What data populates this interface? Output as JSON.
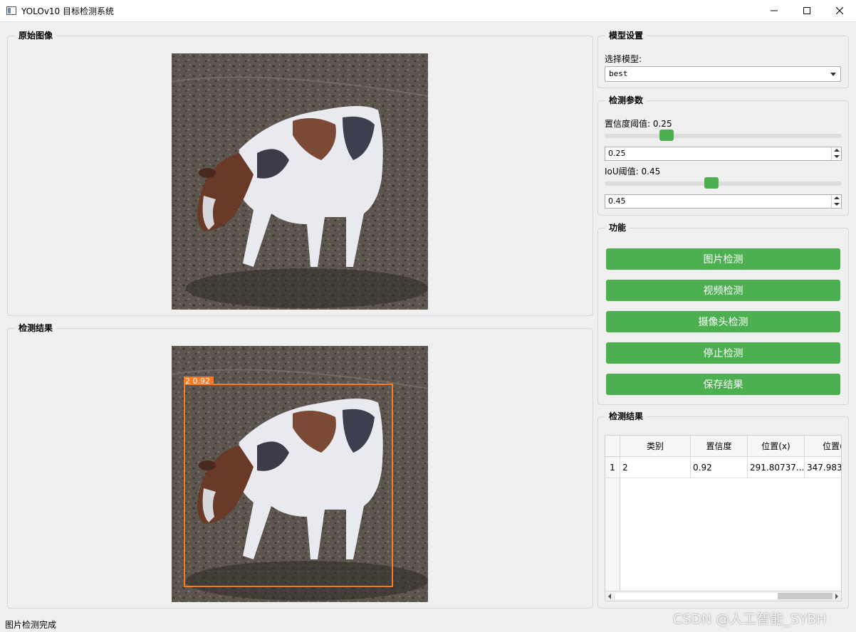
{
  "window": {
    "title": "YOLOv10 目标检测系统"
  },
  "original_panel": {
    "title": "原始图像"
  },
  "result_panel": {
    "title": "检测结果",
    "box_label": "2  0.92",
    "box_color": "#ff7a22"
  },
  "model_settings": {
    "title": "模型设置",
    "select_label": "选择模型:",
    "selected_model": "best"
  },
  "detect_params": {
    "title": "检测参数",
    "conf_label": "置信度阈值: 0.25",
    "conf_value": "0.25",
    "conf_fraction": 0.25,
    "iou_label": "IoU阈值: 0.45",
    "iou_value": "0.45",
    "iou_fraction": 0.45
  },
  "functions": {
    "title": "功能",
    "buttons": [
      "图片检测",
      "视频检测",
      "摄像头检测",
      "停止检测",
      "保存结果"
    ],
    "accent_color": "#4caf50"
  },
  "results_table": {
    "title": "检测结果",
    "columns": [
      "类别",
      "置信度",
      "位置(x)",
      "位置("
    ],
    "rows": [
      {
        "index": "1",
        "cells": [
          "2",
          "0.92",
          "291.80737...",
          "347.9830"
        ]
      }
    ]
  },
  "status_bar": {
    "text": "图片检测完成"
  },
  "watermark": "CSDN @人工智能_SYBH"
}
